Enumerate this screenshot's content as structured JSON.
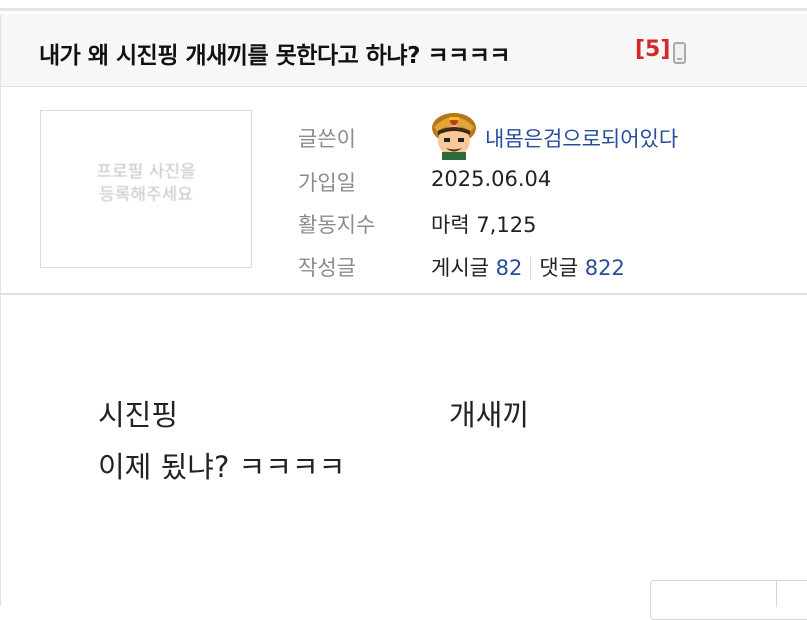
{
  "post": {
    "title": "내가 왜 시진핑 개새끼를 못한다고 하냐? ㅋㅋㅋㅋ",
    "comment_count": "[5]",
    "device_icon": "mobile-icon"
  },
  "profile": {
    "placeholder": "프로필 사진을\n등록해주세요"
  },
  "info": {
    "author_label": "글쓴이",
    "author_value": "내몸은검으로되어있다",
    "joined_label": "가입일",
    "joined_value": "2025.06.04",
    "activity_label": "활동지수",
    "activity_value": "마력 7,125",
    "posts_label": "작성글",
    "posts_text": "게시글",
    "posts_count": "82",
    "comments_text": "댓글",
    "comments_count": "822"
  },
  "body": {
    "line1_left": "시진핑",
    "line1_right": "개새끼",
    "line2": "이제 됬냐? ㅋㅋㅋㅋ"
  }
}
